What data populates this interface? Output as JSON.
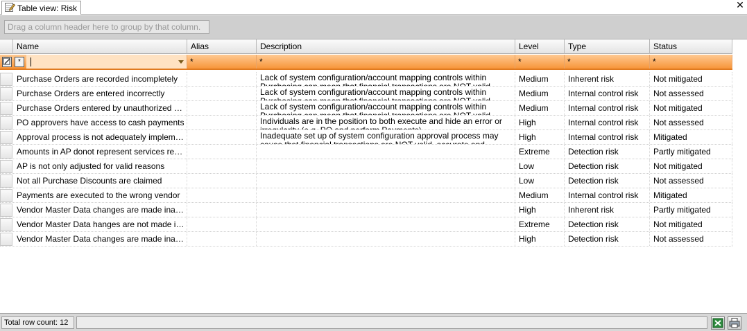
{
  "tab": {
    "title": "Table view: Risk",
    "close_glyph": "✕"
  },
  "group_panel": {
    "hint": "Drag a column header here to group by that column."
  },
  "columns": [
    "Name",
    "Alias",
    "Description",
    "Level",
    "Type",
    "Status"
  ],
  "filter": {
    "name_value": "",
    "wildcard": "*"
  },
  "rows": [
    {
      "name": "Purchase Orders are recorded incompletely",
      "alias": "",
      "description": "Lack of system configuration/account mapping controls within Purchasing can mean that financial transactions are NOT valid",
      "level": "Medium",
      "type": "Inherent risk",
      "status": "Not mitigated"
    },
    {
      "name": "Purchase Orders are entered incorrectly",
      "alias": "",
      "description": "Lack of system configuration/account mapping controls within Purchasing can mean that financial transactions are NOT valid",
      "level": "Medium",
      "type": "Internal control risk",
      "status": "Not assessed"
    },
    {
      "name": "Purchase Orders entered by unauthorized per…",
      "alias": "",
      "description": "Lack of system configuration/account mapping controls within Purchasing can mean that financial transactions are NOT valid",
      "level": "Medium",
      "type": "Internal control risk",
      "status": "Not mitigated"
    },
    {
      "name": "PO approvers have access to cash payments",
      "alias": "",
      "description": "Individuals are in the position to both execute and hide an error or irregularity (e.g. PO and perform Payments)",
      "level": "High",
      "type": "Internal control risk",
      "status": "Not assessed"
    },
    {
      "name": "Approval process is not adequately implement…",
      "alias": "",
      "description": "Inadequate set up of system configuration approval process may cause that financial transactions are NOT valid, accurate and complete",
      "level": "High",
      "type": "Internal control risk",
      "status": "Mitigated"
    },
    {
      "name": "Amounts in AP donot represent services receiv…",
      "alias": "",
      "description": "",
      "level": "Extreme",
      "type": "Detection risk",
      "status": "Partly mitigated"
    },
    {
      "name": "AP is not only adjusted for valid reasons",
      "alias": "",
      "description": "",
      "level": "Low",
      "type": "Detection risk",
      "status": "Not mitigated"
    },
    {
      "name": "Not all Purchase Discounts are claimed",
      "alias": "",
      "description": "",
      "level": "Low",
      "type": "Detection risk",
      "status": "Not assessed"
    },
    {
      "name": "Payments are executed to the wrong vendor",
      "alias": "",
      "description": "",
      "level": "Medium",
      "type": "Internal control risk",
      "status": "Mitigated"
    },
    {
      "name": "Vendor Master Data changes are made inaccu…",
      "alias": "",
      "description": "",
      "level": "High",
      "type": "Inherent risk",
      "status": "Partly mitigated"
    },
    {
      "name": "Vendor Master Data hanges are not made in ti…",
      "alias": "",
      "description": "",
      "level": "Extreme",
      "type": "Detection risk",
      "status": "Not mitigated"
    },
    {
      "name": "Vendor Master Data changes are made inaccu…",
      "alias": "",
      "description": "",
      "level": "High",
      "type": "Detection risk",
      "status": "Not assessed"
    }
  ],
  "status_bar": {
    "row_count": "Total row count: 12"
  },
  "icons": {
    "tab": "table-edit-icon",
    "excel": "excel-export-icon",
    "print": "print-icon"
  },
  "colors": {
    "filter_row": "#f7953a",
    "excel_green": "#1e7b34"
  }
}
